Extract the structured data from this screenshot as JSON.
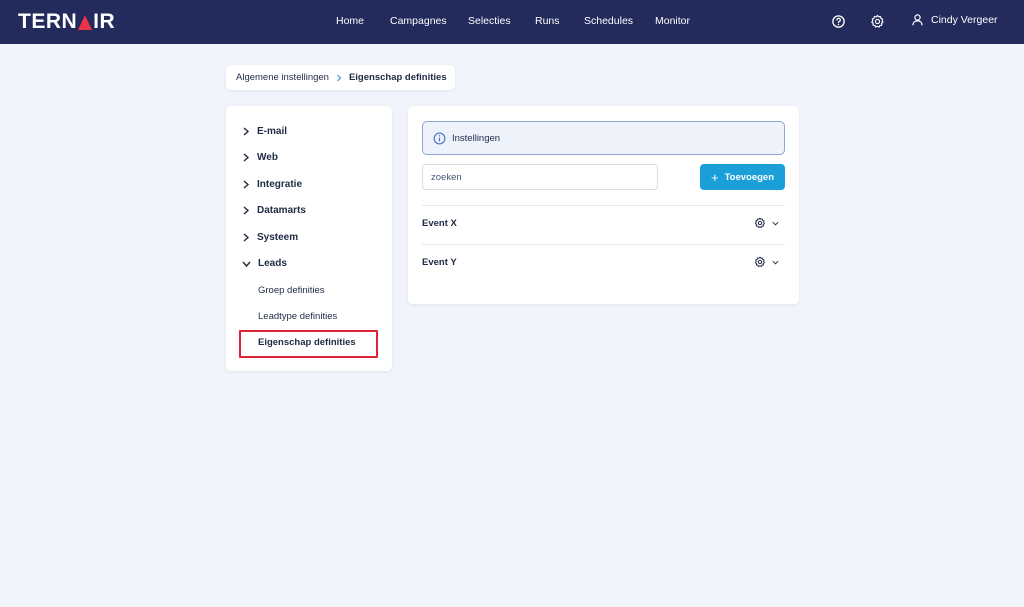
{
  "brand": {
    "name_part1": "TERN",
    "name_part2": "IR",
    "accent": "#e8334a",
    "topbar_bg": "#232a5c"
  },
  "nav": {
    "items": [
      {
        "label": "Home"
      },
      {
        "label": "Campagnes"
      },
      {
        "label": "Selecties"
      },
      {
        "label": "Runs"
      },
      {
        "label": "Schedules"
      },
      {
        "label": "Monitor"
      }
    ]
  },
  "header_actions": {
    "help_icon": "help-icon",
    "settings_icon": "gear-icon",
    "user_name": "Cindy Vergeer"
  },
  "breadcrumb": {
    "parent": "Algemene instellingen",
    "current": "Eigenschap definities"
  },
  "sidebar": {
    "groups": [
      {
        "label": "E-mail",
        "expanded": false
      },
      {
        "label": "Web",
        "expanded": false
      },
      {
        "label": "Integratie",
        "expanded": false
      },
      {
        "label": "Datamarts",
        "expanded": false
      },
      {
        "label": "Systeem",
        "expanded": false
      },
      {
        "label": "Leads",
        "expanded": true
      }
    ],
    "sub_items": [
      {
        "label": "Groep definities"
      },
      {
        "label": "Leadtype definities"
      },
      {
        "label": "Eigenschap definities",
        "active": true
      }
    ]
  },
  "main": {
    "info_label": "Instellingen",
    "search_placeholder": "zoeken",
    "add_button": "Toevoegen",
    "rows": [
      {
        "label": "Event X"
      },
      {
        "label": "Event Y"
      }
    ],
    "button_color": "#1a9fd9",
    "highlight_color": "#e0223a"
  }
}
